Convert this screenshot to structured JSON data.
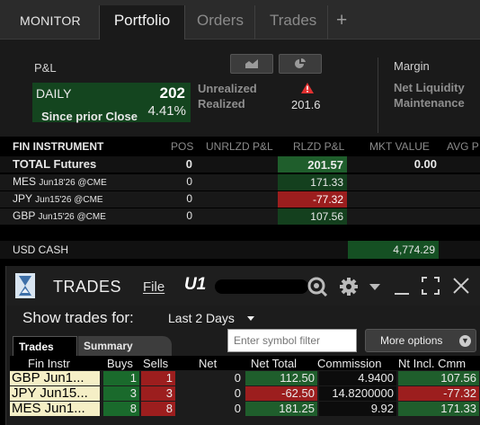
{
  "tabs": {
    "monitor": "MONITOR",
    "portfolio": "Portfolio",
    "orders": "Orders",
    "trades": "Trades",
    "add": "+"
  },
  "pnl": {
    "label": "P&L",
    "daily_label": "DAILY",
    "daily_value": "202",
    "since_label": "Since prior Close",
    "since_value": "4.41%",
    "unrealized_label": "Unrealized",
    "realized_label": "Realized",
    "realized_value": "201.6",
    "margin_label": "Margin",
    "net_liquidity_label": "Net Liquidity",
    "maintenance_label": "Maintenance"
  },
  "portfolio": {
    "headers": {
      "instrument": "FIN INSTRUMENT",
      "pos": "POS",
      "unrlzd": "UNRLZD P&L",
      "rlzd": "RLZD P&L",
      "mkt": "MKT VALUE",
      "avg": "AVG P"
    },
    "total": {
      "name": "TOTAL Futures",
      "pos": "0",
      "rlzd": "201.57",
      "mkt": "0.00"
    },
    "rows": [
      {
        "sym": "MES",
        "exp": "Jun18'26 @CME",
        "pos": "0",
        "rlzd": "171.33"
      },
      {
        "sym": "JPY",
        "exp": "Jun15'26 @CME",
        "pos": "0",
        "rlzd": "-77.32"
      },
      {
        "sym": "GBP",
        "exp": "Jun15'26 @CME",
        "pos": "0",
        "rlzd": "107.56"
      }
    ],
    "cash": {
      "label": "USD CASH",
      "value": "4,774.29"
    }
  },
  "trades_window": {
    "title": "TRADES",
    "file_menu": "File",
    "account": "U1",
    "show_label": "Show trades for:",
    "period": "Last 2 Days",
    "tab_trades": "Trades",
    "tab_summary": "Summary",
    "filter_placeholder": "Enter symbol filter",
    "more_options": "More options",
    "columns": {
      "instr": "Fin Instr",
      "buys": "Buys",
      "sells": "Sells",
      "net": "Net",
      "net_total": "Net Total",
      "commission": "Commission",
      "net_incl": "Nt Incl. Cmm"
    },
    "rows": [
      {
        "instr": "GBP Jun1...",
        "buys": "1",
        "sells": "1",
        "net": "0",
        "net_total": "112.50",
        "commission": "4.9400",
        "net_incl": "107.56"
      },
      {
        "instr": "JPY Jun15...",
        "buys": "3",
        "sells": "3",
        "net": "0",
        "net_total": "-62.50",
        "commission": "14.8200000",
        "net_incl": "-77.32"
      },
      {
        "instr": "MES Jun1...",
        "buys": "8",
        "sells": "8",
        "net": "0",
        "net_total": "181.25",
        "commission": "9.92",
        "net_incl": "171.33"
      }
    ]
  },
  "colors": {
    "green": "#1f5e2c",
    "red": "#9c1e1e",
    "instr_bg": "#f5efc6",
    "warning": "#e03030"
  }
}
